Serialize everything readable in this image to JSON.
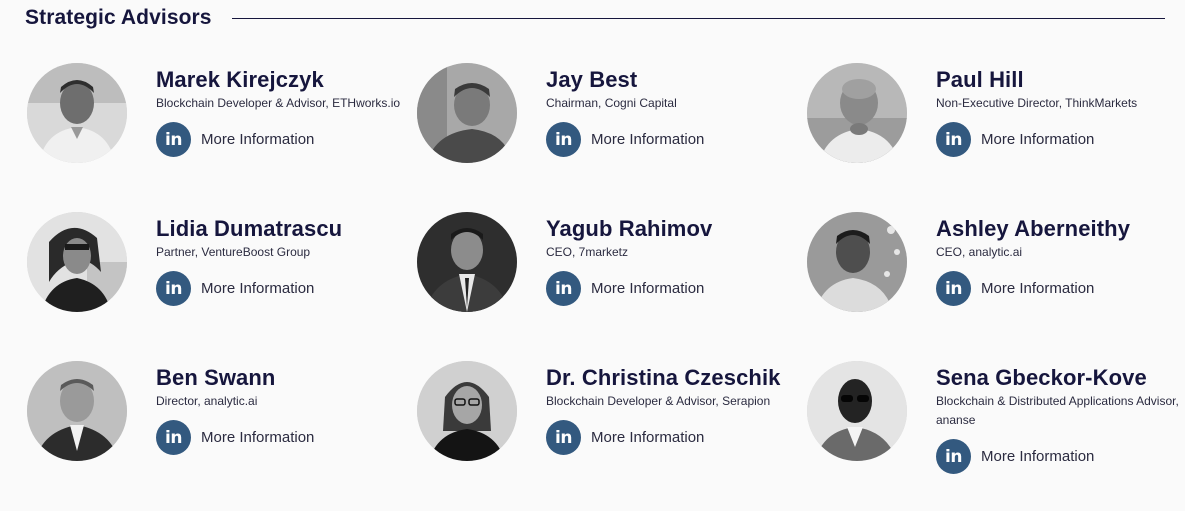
{
  "section": {
    "title": "Strategic Advisors"
  },
  "advisors": [
    {
      "name": "Marek Kirejczyk",
      "role": "Blockchain Developer & Advisor, ETHworks.io",
      "link_label": "More Information",
      "icon": "linkedin-icon",
      "link_icon_text": "in"
    },
    {
      "name": "Jay Best",
      "role": "Chairman, Cogni Capital",
      "link_label": "More Information",
      "icon": "linkedin-icon",
      "link_icon_text": "in"
    },
    {
      "name": "Paul Hill",
      "role": "Non-Executive Director, ThinkMarkets",
      "link_label": "More Information",
      "icon": "linkedin-icon",
      "link_icon_text": "in"
    },
    {
      "name": "Lidia Dumatrascu",
      "role": "Partner, VentureBoost Group",
      "link_label": "More Information",
      "icon": "linkedin-icon",
      "link_icon_text": "in"
    },
    {
      "name": "Yagub Rahimov",
      "role": "CEO, 7marketz",
      "link_label": "More Information",
      "icon": "linkedin-icon",
      "link_icon_text": "in"
    },
    {
      "name": "Ashley Aberneithy",
      "role": "CEO, analytic.ai",
      "link_label": "More Information",
      "icon": "linkedin-icon",
      "link_icon_text": "in"
    },
    {
      "name": "Ben Swann",
      "role": "Director, analytic.ai",
      "link_label": "More Information",
      "icon": "linkedin-icon",
      "link_icon_text": "in"
    },
    {
      "name": "Dr. Christina Czeschik",
      "role": "Blockchain Developer & Advisor, Serapion",
      "link_label": "More Information",
      "icon": "linkedin-icon",
      "link_icon_text": "in"
    },
    {
      "name": "Sena Gbeckor-Kove",
      "role": "Blockchain & Distributed Applications Advisor, ananse",
      "link_label": "More Information",
      "icon": "linkedin-icon",
      "link_icon_text": "in"
    }
  ],
  "colors": {
    "heading": "#16163d",
    "linkedin_badge": "#33597f",
    "background": "#fafafa"
  }
}
